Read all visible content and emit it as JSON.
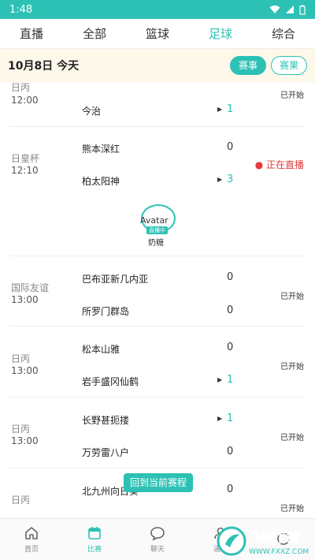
{
  "statusbar": {
    "time": "1:48"
  },
  "top_tabs": [
    {
      "label": "直播",
      "active": false
    },
    {
      "label": "全部",
      "active": false
    },
    {
      "label": "篮球",
      "active": false
    },
    {
      "label": "足球",
      "active": true
    },
    {
      "label": "综合",
      "active": false
    }
  ],
  "datebar": {
    "date": "10月8日 今天",
    "events_label": "赛事",
    "results_label": "赛果"
  },
  "matches": [
    {
      "league": "日丙",
      "time": "12:00",
      "team_home": "",
      "score_home": "",
      "team_away": "今治",
      "score_away": "1",
      "status": "已开始"
    },
    {
      "league": "日皇杯",
      "time": "12:10",
      "team_home": "熊本深红",
      "score_home": "0",
      "team_away": "柏太阳神",
      "score_away": "3",
      "status": "正在直播"
    },
    {
      "league": "国际友谊",
      "time": "13:00",
      "team_home": "巴布亚新几内亚",
      "score_home": "0",
      "team_away": "所罗门群岛",
      "score_away": "0",
      "status": "已开始"
    },
    {
      "league": "日丙",
      "time": "13:00",
      "team_home": "松本山雅",
      "score_home": "0",
      "team_away": "岩手盛冈仙鹤",
      "score_away": "1",
      "status": "已开始"
    },
    {
      "league": "日丙",
      "time": "13:00",
      "team_home": "长野甚扼搂",
      "score_home": "1",
      "team_away": "万劳雷八户",
      "score_away": "0",
      "status": "已开始"
    },
    {
      "league": "日丙",
      "time": "",
      "team_home": "北九州向日葵",
      "score_home": "0",
      "team_away": "",
      "score_away": "",
      "status": "已开始"
    }
  ],
  "anchor": {
    "alt": "Avatar",
    "tag": "直播中",
    "name": "奶糖"
  },
  "back_button": "回到当前赛程",
  "bottom_nav": [
    {
      "label": "首页",
      "icon": "home-icon",
      "active": false
    },
    {
      "label": "比赛",
      "icon": "calendar-icon",
      "active": true
    },
    {
      "label": "聊天",
      "icon": "chat-icon",
      "active": false
    },
    {
      "label": "通讯",
      "icon": "contacts-icon",
      "active": false
    },
    {
      "label": "",
      "icon": "profile-icon",
      "active": false
    }
  ],
  "watermark": {
    "text": "飞翔下载",
    "url": "WWW.FXXZ.COM"
  },
  "colors": {
    "accent": "#2cc1b4",
    "live": "#e23b3b",
    "datebar_bg": "#fdf8ea"
  }
}
